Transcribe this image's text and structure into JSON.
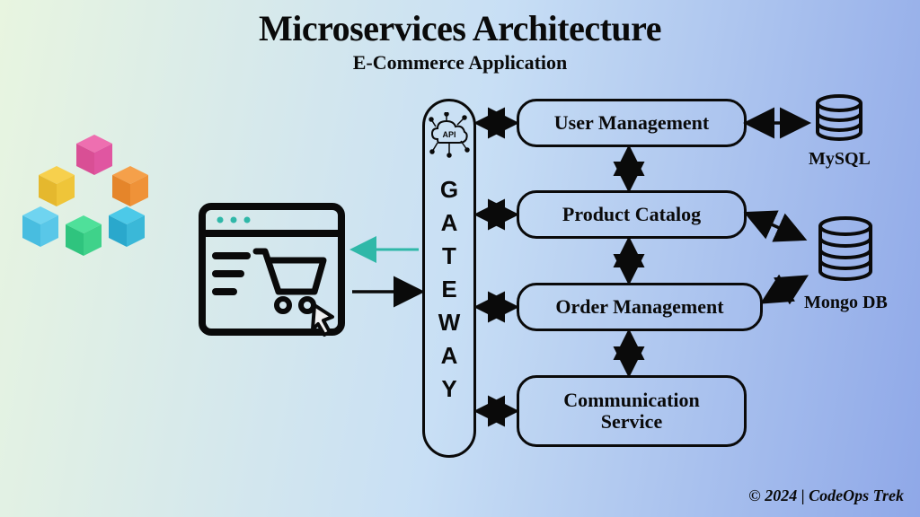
{
  "title": "Microservices Architecture",
  "subtitle": "E-Commerce Application",
  "gateway": {
    "letters": [
      "G",
      "A",
      "T",
      "E",
      "W",
      "A",
      "Y"
    ],
    "api_label": "API"
  },
  "services": [
    "User Management",
    "Product Catalog",
    "Order Management",
    "Communication Service"
  ],
  "databases": [
    {
      "label": "MySQL"
    },
    {
      "label": "Mongo DB"
    }
  ],
  "footer": "© 2024 | CodeOps Trek",
  "cube_colors": [
    "#e85fa0",
    "#f5c542",
    "#f08a3a",
    "#3fd98a",
    "#4fc8f5",
    "#2aa8d8"
  ]
}
